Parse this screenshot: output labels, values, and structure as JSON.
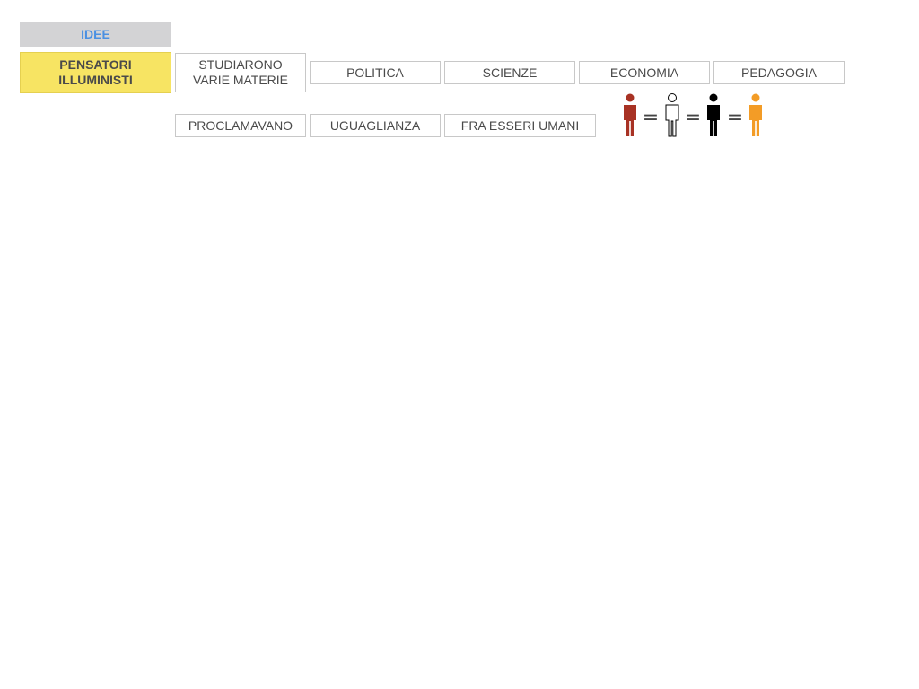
{
  "title": "IDEE",
  "main_concept": "PENSATORI\nILLUMINISTI",
  "row1": {
    "verb": "STUDIARONO\nVARIE MATERIE",
    "subjects": [
      "POLITICA",
      "SCIENZE",
      "ECONOMIA",
      "PEDAGOGIA"
    ]
  },
  "row2": {
    "verb": "PROCLAMAVANO",
    "items": [
      "UGUAGLIANZA",
      "FRA ESSERI UMANI"
    ]
  },
  "equality_figures": {
    "colors": [
      "#a83224",
      "#ffffff",
      "#000000",
      "#f39c26"
    ],
    "separator": "="
  }
}
